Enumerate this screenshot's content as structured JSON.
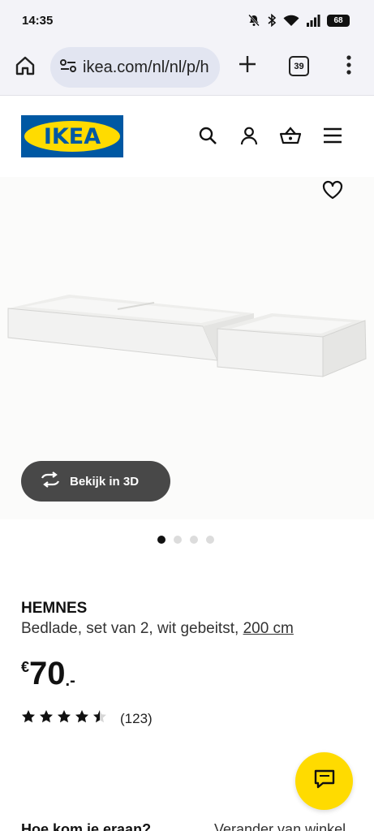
{
  "status_bar": {
    "time": "14:35",
    "battery": "68",
    "icons": [
      "bell-off-icon",
      "bluetooth-icon",
      "wifi-icon",
      "signal-icon",
      "battery-icon"
    ]
  },
  "browser": {
    "url": "ikea.com/nl/nl/p/h",
    "tab_count": "39",
    "icons": [
      "home-icon",
      "site-settings-icon",
      "plus-icon",
      "tabs-icon",
      "more-vert-icon"
    ]
  },
  "header": {
    "logo_text": "IKEA",
    "icons": [
      "search-icon",
      "user-icon",
      "basket-icon",
      "hamburger-menu-icon"
    ]
  },
  "product": {
    "view_3d_label": "Bekijk in 3D",
    "carousel": {
      "total": 4,
      "active_index": 0
    },
    "name": "HEMNES",
    "description": "Bedlade, set van 2, wit gebeitst, ",
    "size": "200 cm",
    "price": {
      "currency": "€",
      "integer": "70",
      "decimals": ".-"
    },
    "rating": {
      "value": 4.5,
      "max": 5,
      "count": "(123)"
    }
  },
  "bottom": {
    "left_text": "Hoe kom je eraan?",
    "right_text": "Verander van winkel"
  },
  "colors": {
    "ikea_blue": "#0058a3",
    "ikea_yellow": "#ffdb00",
    "button_dark": "#484848"
  }
}
